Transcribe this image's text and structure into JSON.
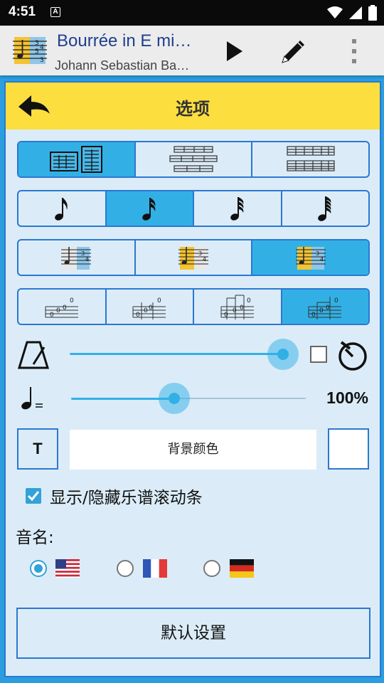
{
  "status_bar": {
    "time": "4:51",
    "notification_badge": "A",
    "icons": [
      "wifi-icon",
      "signal-icon",
      "battery-icon"
    ]
  },
  "app_bar": {
    "title": "Bourrée in E mi…",
    "subtitle": "Johann Sebastian Ba…",
    "actions": [
      "play-icon",
      "edit-pencil-icon",
      "more-vertical-icon"
    ]
  },
  "options": {
    "title": "选项",
    "layout_segments": {
      "items": [
        "layout-score-tab-icon",
        "layout-score-icon",
        "layout-tab-icon"
      ],
      "selected_index": 0
    },
    "note_segments": {
      "items": [
        "eighth-note-icon",
        "sixteenth-note-icon",
        "thirty-second-note-icon",
        "sixty-fourth-note-icon"
      ],
      "selected_index": 1
    },
    "color_segments": {
      "items": [
        "color-scheme-blue-icon",
        "color-scheme-yellow-icon",
        "color-scheme-yellow-blue-icon"
      ],
      "selected_index": 2
    },
    "tab_style_segments": {
      "items": [
        "tab-style-1-icon",
        "tab-style-2-icon",
        "tab-style-3-icon",
        "tab-style-4-icon"
      ],
      "selected_index": 3
    },
    "metronome_slider": {
      "value": 0.96,
      "checked": false
    },
    "tempo_slider": {
      "value": 0.44,
      "percent_text": "100%"
    },
    "text_button_label": "T",
    "background_color_label": "背景颜色",
    "swatch_color": "#ffffff",
    "scrollbar_toggle": {
      "label": "显示/隐藏乐谱滚动条",
      "checked": true
    },
    "note_names_label": "音名:",
    "note_name_options": [
      {
        "flag": "us-flag-icon",
        "checked": true
      },
      {
        "flag": "fr-flag-icon",
        "checked": false
      },
      {
        "flag": "de-flag-icon",
        "checked": false
      }
    ],
    "default_button_label": "默认设置"
  },
  "colors": {
    "accent": "#32b0e6",
    "border": "#2b78d0",
    "header": "#fcdf3f",
    "panel": "#dbecf8"
  }
}
